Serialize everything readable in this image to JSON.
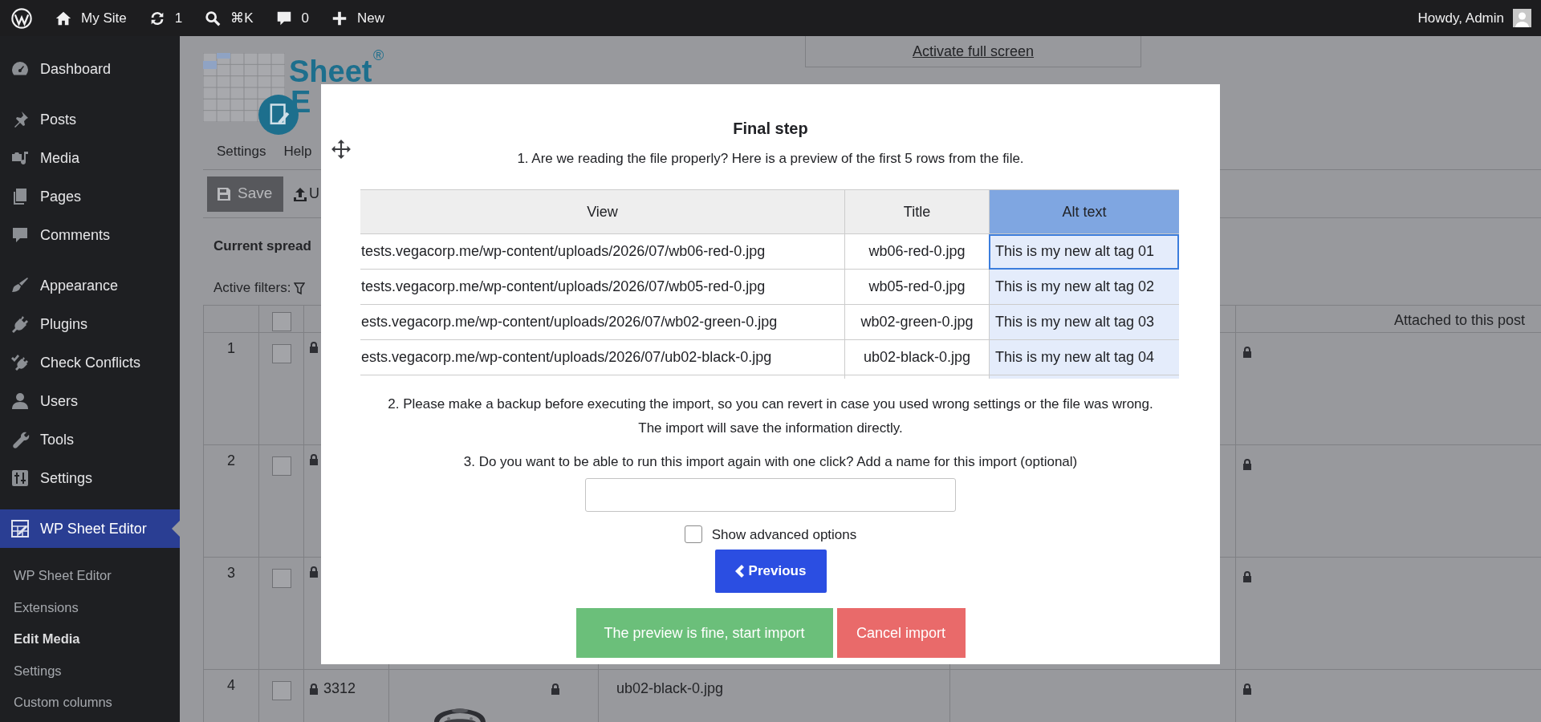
{
  "admin_bar": {
    "items": [
      {
        "kind": "logo"
      },
      {
        "kind": "home",
        "label": "My Site"
      },
      {
        "kind": "updates",
        "label": "1"
      },
      {
        "kind": "search",
        "label": "⌘K"
      },
      {
        "kind": "comments",
        "label": "0"
      },
      {
        "kind": "new",
        "label": "New"
      }
    ],
    "greeting": "Howdy, Admin"
  },
  "sidebar": {
    "groups": [
      [
        {
          "label": "Dashboard",
          "selected": false
        }
      ],
      [
        {
          "label": "Posts",
          "selected": false
        },
        {
          "label": "Media",
          "selected": false
        },
        {
          "label": "Pages",
          "selected": false
        },
        {
          "label": "Comments",
          "selected": false
        }
      ],
      [
        {
          "label": "Appearance",
          "selected": false
        },
        {
          "label": "Plugins",
          "selected": false
        },
        {
          "label": "Check Conflicts",
          "selected": false
        },
        {
          "label": "Users",
          "selected": false
        },
        {
          "label": "Tools",
          "selected": false
        },
        {
          "label": "Settings",
          "selected": false
        }
      ],
      [
        {
          "label": "WP Sheet Editor",
          "selected": true
        }
      ]
    ],
    "submenu": [
      {
        "label": "WP Sheet Editor",
        "selected": false
      },
      {
        "label": "Extensions",
        "selected": false
      },
      {
        "label": "Edit Media",
        "selected": true
      },
      {
        "label": "Settings",
        "selected": false
      },
      {
        "label": "Custom columns",
        "selected": false
      }
    ]
  },
  "page": {
    "fullscreen_link": "Activate full screen",
    "logo": {
      "line1": "Sheet",
      "mark": "®",
      "line2": "E"
    },
    "menu": [
      "Settings",
      "Help"
    ],
    "toolbar": [
      {
        "kind": "save",
        "label": "Save"
      },
      {
        "kind": "upload",
        "label": "U"
      }
    ],
    "current_label": "Current spread",
    "filters_label": "Active filters:",
    "sheet": {
      "header_checked": false,
      "attached_heading": "Attached to this post",
      "rows": [
        {
          "number": "1",
          "checked": false
        },
        {
          "number": "2",
          "checked": false
        },
        {
          "number": "3",
          "checked": false
        },
        {
          "number": "4",
          "checked": false,
          "id": "3312",
          "title": "ub02-black-0.jpg"
        }
      ]
    }
  },
  "dialog": {
    "title": "Final step",
    "step1": "1. Are we reading the file properly? Here is a preview of the first 5 rows from the file.",
    "preview": {
      "columns": [
        {
          "label": "View",
          "selected": false
        },
        {
          "label": "Title",
          "selected": false
        },
        {
          "label": "Alt text",
          "selected": true
        }
      ],
      "rows": [
        {
          "cells": [
            "tests.vegacorp.me/wp-content/uploads/2026/07/wb06-red-0.jpg",
            "wb06-red-0.jpg",
            "This is my new alt tag 01"
          ],
          "selected": true
        },
        {
          "cells": [
            "tests.vegacorp.me/wp-content/uploads/2026/07/wb05-red-0.jpg",
            "wb05-red-0.jpg",
            "This is my new alt tag 02"
          ],
          "selected": false
        },
        {
          "cells": [
            "ests.vegacorp.me/wp-content/uploads/2026/07/wb02-green-0.jpg",
            "wb02-green-0.jpg",
            "This is my new alt tag 03"
          ],
          "selected": false
        },
        {
          "cells": [
            "ests.vegacorp.me/wp-content/uploads/2026/07/ub02-black-0.jpg",
            "ub02-black-0.jpg",
            "This is my new alt tag 04"
          ],
          "selected": false
        }
      ]
    },
    "step2": "2. Please make a backup before executing the import, so you can revert in case you used wrong settings or the file was wrong. The import will save the information directly.",
    "step3": "3. Do you want to be able to run this import again with one click? Add a name for this import (optional)",
    "advanced": {
      "label": "Show advanced options",
      "checked": false
    },
    "buttons": [
      {
        "kind": "previous",
        "label": "Previous"
      },
      {
        "kind": "start",
        "label": "The preview is fine, start import"
      },
      {
        "kind": "cancel",
        "label": "Cancel import"
      }
    ]
  }
}
